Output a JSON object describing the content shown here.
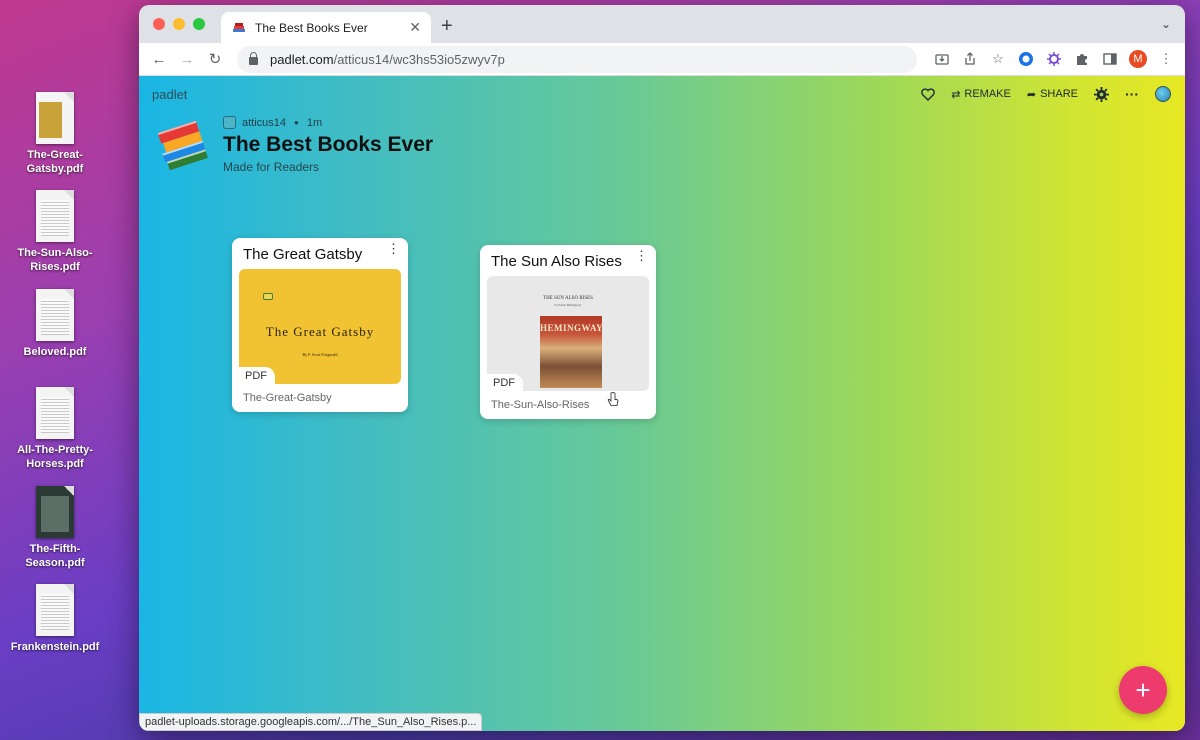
{
  "desktop": {
    "files": [
      {
        "label": "The-Great-\nGatsby.pdf"
      },
      {
        "label": "The-Sun-Also-\nRises.pdf"
      },
      {
        "label": "Beloved.pdf"
      },
      {
        "label": "All-The-Pretty-\nHorses.pdf"
      },
      {
        "label": "The-Fifth-\nSeason.pdf"
      },
      {
        "label": "Frankenstein.pdf"
      }
    ]
  },
  "browser": {
    "tab_title": "The Best Books Ever",
    "tab_close": "✕",
    "new_tab": "+",
    "tab_menu": "⌄",
    "url_host": "padlet.com",
    "url_path": "/atticus14/wc3hs53io5zwyv7p",
    "profile_initial": "M",
    "status_url": "padlet-uploads.storage.googleapis.com/.../The_Sun_Also_Rises.p..."
  },
  "padlet": {
    "logo": "padlet",
    "actions": {
      "remake": "REMAKE",
      "share": "SHARE"
    },
    "author": "atticus14",
    "time_ago": "1m",
    "title": "The Best Books Ever",
    "subtitle": "Made for Readers",
    "cards": [
      {
        "title": "The Great Gatsby",
        "tag": "PDF",
        "caption": "The-Great-Gatsby",
        "cover_title": "The Great Gatsby",
        "cover_by": "By F. Scott Fitzgerald"
      },
      {
        "title": "The Sun Also Rises",
        "tag": "PDF",
        "caption": "The-Sun-Also-Rises",
        "cover_title": "THE SUN ALSO RISES",
        "cover_by": "by Ernest Hemingway",
        "cover_author": "HEMINGWAY"
      }
    ],
    "fab_label": "+"
  },
  "colors": {
    "fab": "#ec3b6c",
    "gatsby_cover": "#f1c231",
    "gradient_left": "#19b6e5",
    "gradient_right": "#e7e823"
  }
}
